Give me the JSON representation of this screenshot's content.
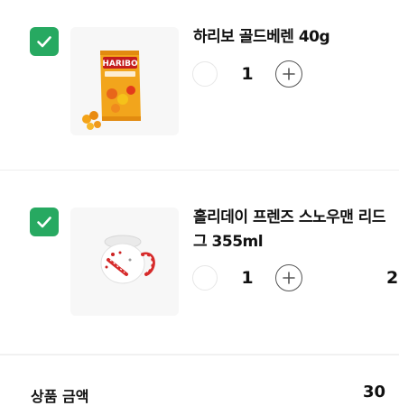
{
  "colors": {
    "checkbox": "#27a961",
    "text": "#111111",
    "divider": "#eeeeee"
  },
  "items": [
    {
      "name": "하리보 골드베렌 40g",
      "quantity": "1",
      "checked": true,
      "image_icon": "gummy-bear-bag-icon",
      "image_brand_text": "HARIBO"
    },
    {
      "name_line1": "홀리데이 프렌즈 스노우맨 리드",
      "name_line2": "그 355ml",
      "quantity": "1",
      "price_partial": "2",
      "checked": true,
      "image_icon": "snowman-mug-icon"
    }
  ],
  "summary": {
    "label_partial": "상품 금액",
    "value_partial": "30"
  }
}
